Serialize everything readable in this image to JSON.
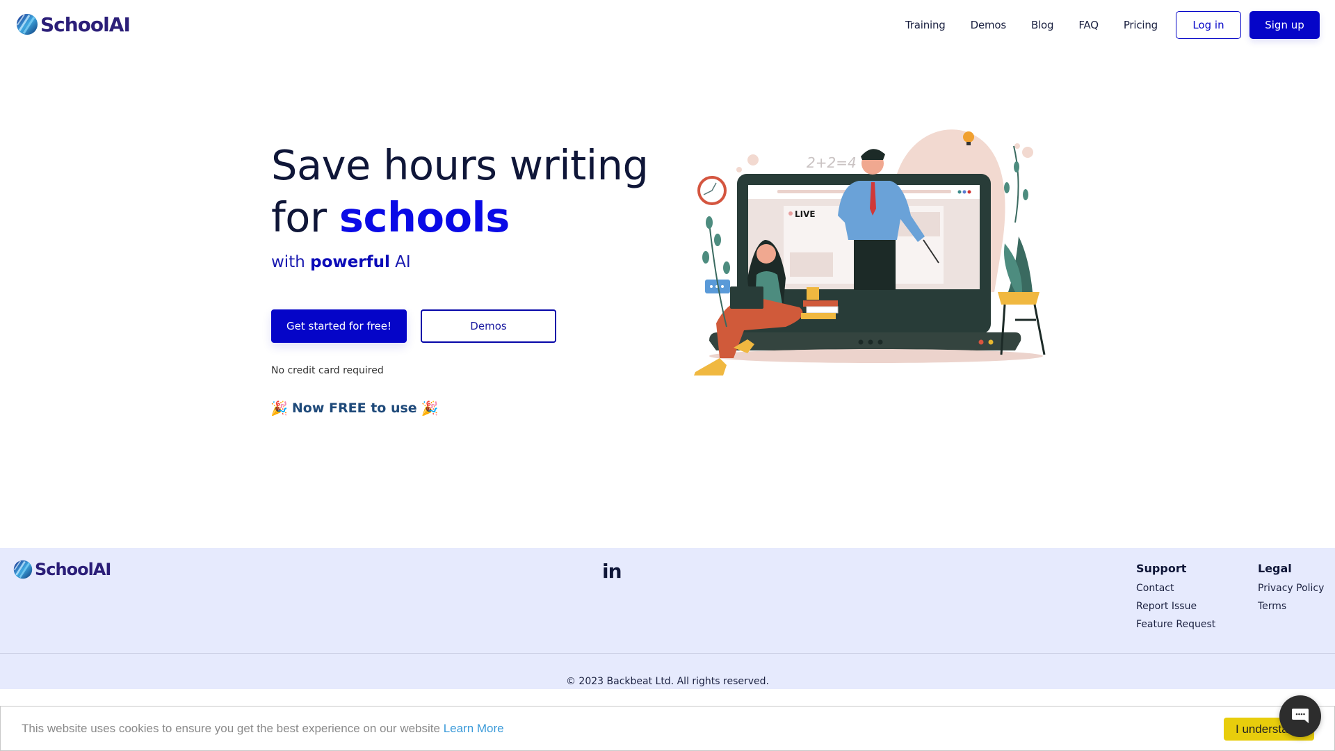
{
  "brand": {
    "name": "SchoolAI",
    "primary_color": "#0505c8",
    "accent_text_color": "#0a0ae6",
    "footer_bg": "#e6eafd"
  },
  "header": {
    "logo_text": "SchoolAI",
    "nav": [
      {
        "label": "Training"
      },
      {
        "label": "Demos"
      },
      {
        "label": "Blog"
      },
      {
        "label": "FAQ"
      },
      {
        "label": "Pricing"
      }
    ],
    "login_label": "Log in",
    "signup_label": "Sign up"
  },
  "hero": {
    "headline_line1": "Save hours writing",
    "headline_line2_prefix": "for ",
    "headline_line2_accent": "schools",
    "subline_prefix": "with ",
    "subline_bold": "powerful",
    "subline_suffix": " AI",
    "cta_primary": "Get started for free!",
    "cta_secondary": "Demos",
    "no_credit_card": "No credit card required",
    "free_note": "Now FREE to use",
    "party_emoji": "🎉",
    "illustration": {
      "live_label": "LIVE",
      "equation": "2+2=4"
    }
  },
  "footer": {
    "logo_text": "SchoolAI",
    "social": [
      {
        "icon": "linkedin-icon",
        "label": "in"
      }
    ],
    "columns": [
      {
        "title": "Support",
        "links": [
          "Contact",
          "Report Issue",
          "Feature Request"
        ]
      },
      {
        "title": "Legal",
        "links": [
          "Privacy Policy",
          "Terms"
        ]
      }
    ],
    "copyright": "© 2023 Backbeat Ltd. All rights reserved."
  },
  "cookie_banner": {
    "message": "This website uses cookies to ensure you get the best experience on our website ",
    "link_label": "Learn More",
    "button_label": "I understand"
  },
  "chat_widget": {
    "icon": "chat-bubble-icon"
  }
}
